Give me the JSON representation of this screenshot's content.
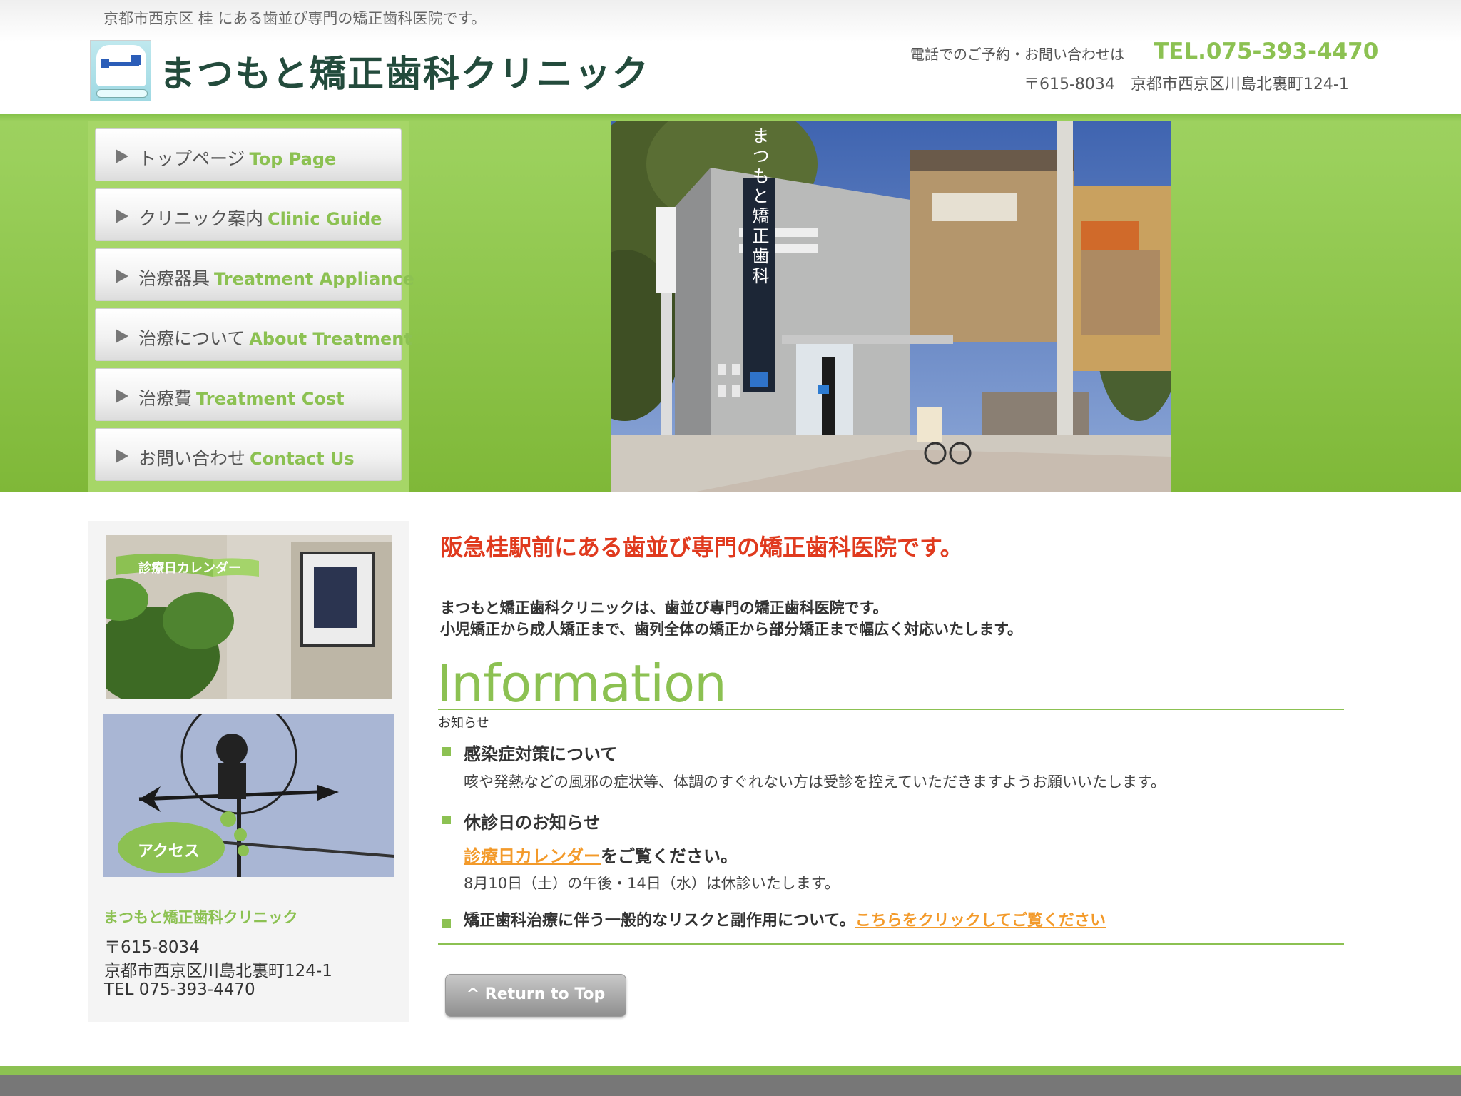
{
  "header": {
    "tagline": "京都市西京区 桂 にある歯並び専門の矯正歯科医院です。",
    "clinic_name": "まつもと矯正歯科クリニック",
    "phone_lead": "電話でのご予約・お問い合わせは",
    "phone": "TEL.075-393-4470",
    "address": "〒615-8034　京都市西京区川島北裏町124-1"
  },
  "nav": {
    "items": [
      {
        "ja": "トップページ",
        "en": "Top Page"
      },
      {
        "ja": "クリニック案内",
        "en": "Clinic Guide"
      },
      {
        "ja": "治療器具",
        "en": "Treatment Appliance"
      },
      {
        "ja": "治療について",
        "en": "About Treatment"
      },
      {
        "ja": "治療費",
        "en": "Treatment Cost"
      },
      {
        "ja": "お問い合わせ",
        "en": "Contact Us"
      }
    ]
  },
  "hero": {
    "sign_text": "まつもと矯正歯科"
  },
  "sidebar": {
    "calendar_banner": "診療日カレンダー",
    "access_banner": "アクセス",
    "clinic_name": "まつもと矯正歯科クリニック",
    "postal": "〒615-8034",
    "address": "京都市西京区川島北裏町124-1",
    "tel": "TEL 075-393-4470"
  },
  "main": {
    "lead_title": "阪急桂駅前にある歯並び専門の矯正歯科医院です。",
    "lead_line1": "まつもと矯正歯科クリニックは、歯並び専門の矯正歯科医院です。",
    "lead_line2": "小児矯正から成人矯正まで、歯列全体の矯正から部分矯正まで幅広く対応いたします。",
    "info_title": "Information",
    "info_sub": "お知らせ",
    "news": [
      {
        "title": "感染症対策について",
        "body": "咳や発熱などの風邪の症状等、体調のすぐれない方は受診を控えていただきますようお願いいたします。"
      },
      {
        "title": "休診日のお知らせ",
        "link": "診療日カレンダー",
        "link_suffix": "をご覧ください。",
        "body": "8月10日（土）の午後・14日（水）は休診いたします。"
      },
      {
        "title": "矯正歯科治療に伴う一般的なリスクと副作用について。",
        "link": "こちらをクリックしてご覧ください"
      }
    ],
    "return_top": "^ Return to Top"
  },
  "colors": {
    "accent_green": "#8cc152",
    "lead_red": "#e03a1e",
    "link_orange": "#f39a2a"
  }
}
